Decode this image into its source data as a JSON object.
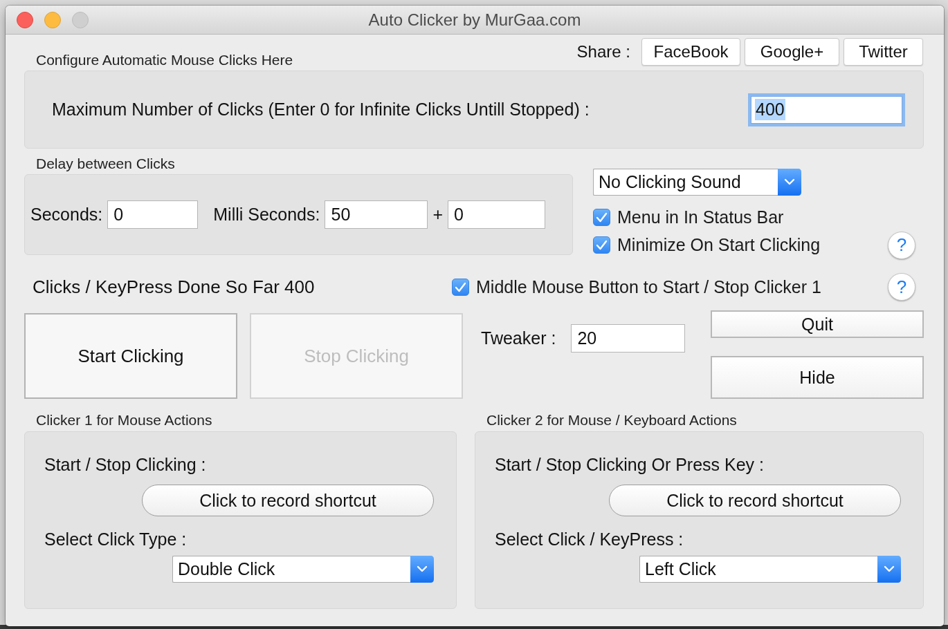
{
  "window": {
    "title": "Auto Clicker by MurGaa.com",
    "controls": [
      {
        "kind": "close",
        "disabled": false
      },
      {
        "kind": "minimize",
        "disabled": false
      },
      {
        "kind": "zoom",
        "disabled": true
      }
    ]
  },
  "header": {
    "title": "Configure Automatic Mouse Clicks Here",
    "share_label": "Share :",
    "share_buttons": [
      "FaceBook",
      "Google+",
      "Twitter"
    ]
  },
  "max_clicks": {
    "label": "Maximum Number of Clicks (Enter 0 for Infinite Clicks Untill Stopped) :",
    "value": "400",
    "focused": true
  },
  "delay": {
    "title": "Delay between Clicks",
    "seconds_label": "Seconds:",
    "seconds_value": "0",
    "ms_label": "Milli Seconds:",
    "ms_value": "50",
    "plus": "+",
    "extra_value": "0"
  },
  "sound_select": {
    "value": "No Clicking Sound"
  },
  "options": [
    {
      "label": "Menu in In Status Bar",
      "checked": true
    },
    {
      "label": "Minimize On Start Clicking",
      "checked": true,
      "help": "?"
    }
  ],
  "counter": {
    "text": "Clicks / KeyPress Done So Far 400"
  },
  "middle_mouse": {
    "label": "Middle Mouse Button to Start / Stop Clicker 1",
    "checked": true,
    "help": "?"
  },
  "actions": [
    {
      "label": "Start Clicking",
      "disabled": false
    },
    {
      "label": "Stop Clicking",
      "disabled": true
    }
  ],
  "tweaker": {
    "label": "Tweaker :",
    "value": "20"
  },
  "side_buttons": [
    "Quit",
    "Hide"
  ],
  "clickers": [
    {
      "title": "Clicker 1 for Mouse Actions",
      "shortcut_label": "Start / Stop Clicking :",
      "shortcut_button": "Click to record shortcut",
      "type_label": "Select Click Type :",
      "type_value": "Double Click"
    },
    {
      "title": "Clicker 2 for Mouse / Keyboard Actions",
      "shortcut_label": "Start / Stop Clicking Or Press Key :",
      "shortcut_button": "Click to record shortcut",
      "type_label": "Select Click / KeyPress :",
      "type_value": "Left Click"
    }
  ]
}
